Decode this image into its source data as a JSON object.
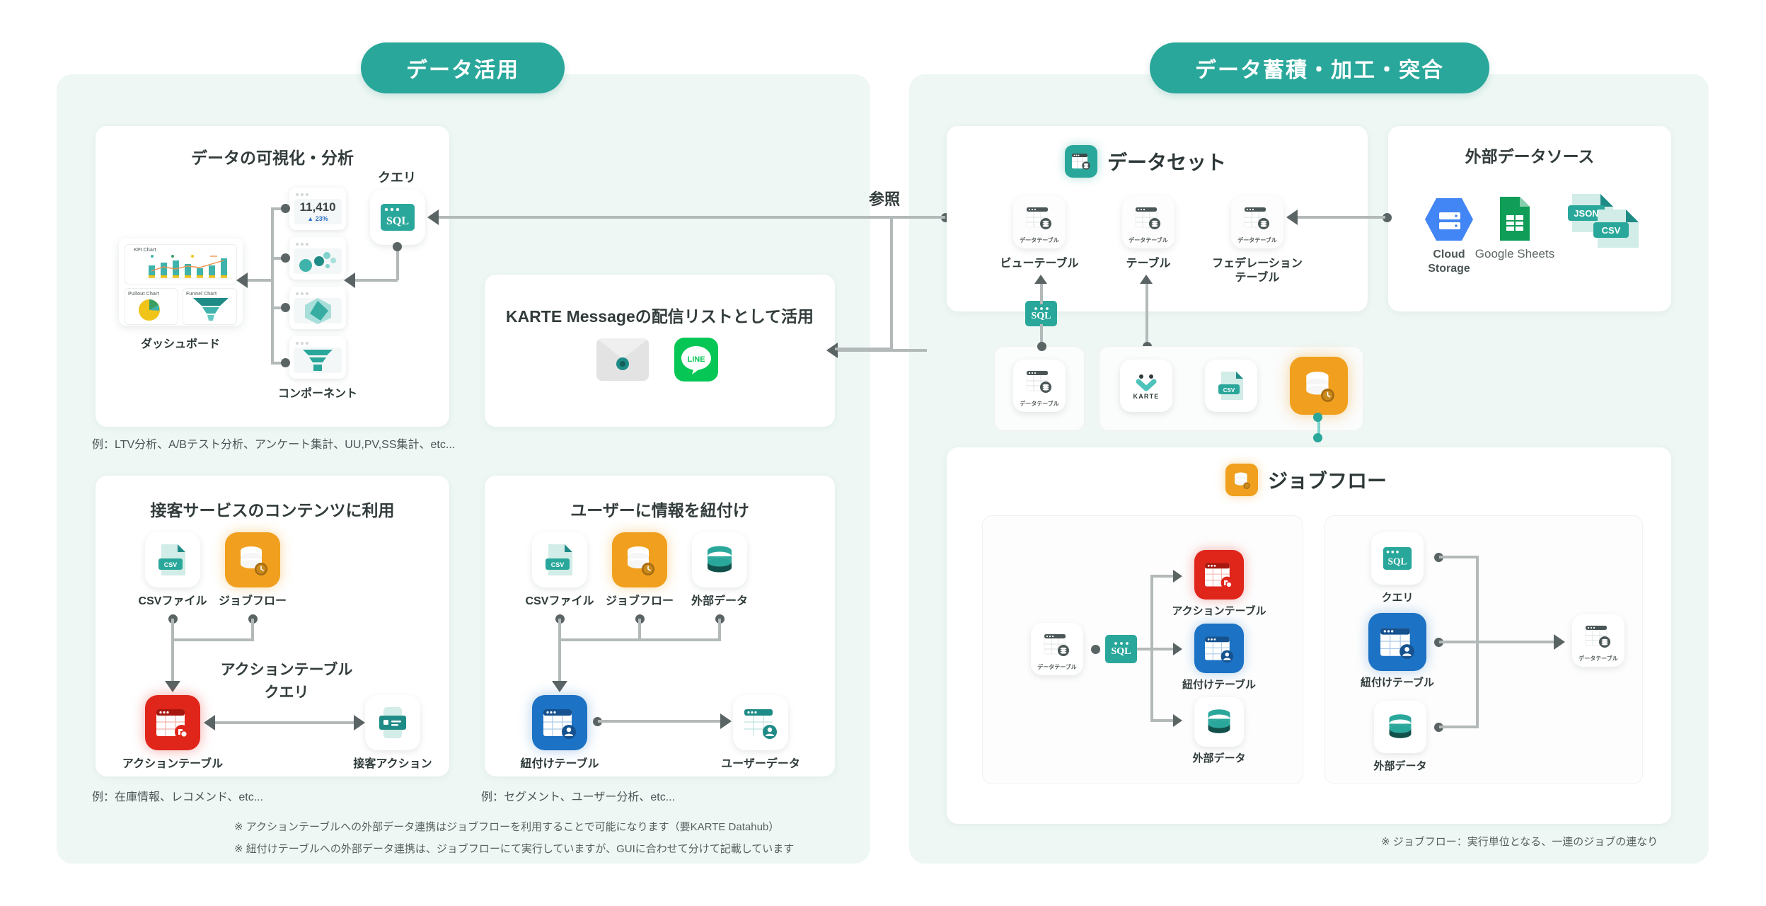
{
  "headers": {
    "left_pill": "データ活用",
    "right_pill": "データ蓄積・加工・突合"
  },
  "connector_labels": {
    "reference": "参照"
  },
  "left_panel": {
    "analysis_card": {
      "title": "データの可視化・分析",
      "dashboard_label": "ダッシュボード",
      "component_label": "コンポーネント",
      "query_label": "クエリ",
      "query_icon_text": "SQL",
      "kpi_value": "11,410",
      "kpi_delta": "▲ 23%",
      "dashboard_charts": [
        {
          "name": "KPI Chart"
        },
        {
          "name": "Pullout Chart"
        },
        {
          "name": "Funnel Chart"
        }
      ],
      "note": "例：LTV分析、A/Bテスト分析、アンケート集計、UU,PV,SS集計、etc..."
    },
    "message_card": {
      "title": "KARTE Messageの配信リストとして活用",
      "channels": [
        {
          "name": "mail-icon",
          "label": ""
        },
        {
          "name": "line-icon",
          "label": "LINE"
        }
      ]
    },
    "service_card": {
      "title": "接客サービスのコンテンツに利用",
      "sources": [
        {
          "label": "CSVファイル",
          "icon": "csv-file-icon",
          "badge": "CSV"
        },
        {
          "label": "ジョブフロー",
          "icon": "jobflow-icon"
        }
      ],
      "flow_label_line1": "アクションテーブル",
      "flow_label_line2": "クエリ",
      "action_table_label": "アクションテーブル",
      "action_label": "接客アクション",
      "note": "例：在庫情報、レコメンド、etc..."
    },
    "user_card": {
      "title": "ユーザーに情報を紐付け",
      "sources": [
        {
          "label": "CSVファイル",
          "icon": "csv-file-icon",
          "badge": "CSV"
        },
        {
          "label": "ジョブフロー",
          "icon": "jobflow-icon"
        },
        {
          "label": "外部データ",
          "icon": "database-icon"
        }
      ],
      "link_table_label": "紐付けテーブル",
      "user_data_label": "ユーザーデータ",
      "note": "例：セグメント、ユーザー分析、etc..."
    },
    "footnotes": [
      "※ アクションテーブルへの外部データ連携はジョブフローを利用することで可能になります（要KARTE Datahub）",
      "※ 紐付けテーブルへの外部データ連携は、ジョブフローにて実行していますが、GUIに合わせて分けて記載しています"
    ]
  },
  "right_panel": {
    "dataset_card": {
      "title": "データセット",
      "tables": [
        {
          "label": "ビューテーブル",
          "micro": "データテーブル"
        },
        {
          "label": "テーブル",
          "micro": "データテーブル"
        },
        {
          "label": "フェデレーションテーブル",
          "micro": "データテーブル"
        }
      ]
    },
    "external_card": {
      "title": "外部データソース",
      "sources": [
        {
          "label": "Cloud Storage",
          "icon": "cloud-storage-icon"
        },
        {
          "label": "Google Sheets",
          "icon": "google-sheets-icon"
        },
        {
          "label": "",
          "icon": "json-csv-files-icon",
          "badges": [
            "JSON",
            "CSV"
          ]
        }
      ]
    },
    "middle_row": {
      "sql_badge": "SQL",
      "data_table_micro": "データテーブル",
      "ingest_items": [
        {
          "label": "KARTE",
          "icon": "karte-icon"
        },
        {
          "label": "CSV",
          "icon": "csv-file-icon"
        },
        {
          "label": "",
          "icon": "jobflow-icon"
        }
      ]
    },
    "jobflow_card": {
      "title": "ジョブフロー",
      "flow_left": {
        "source": {
          "label": "",
          "micro": "データテーブル"
        },
        "sql_badge": "SQL",
        "targets": [
          {
            "label": "アクションテーブル",
            "icon": "action-table-icon"
          },
          {
            "label": "紐付けテーブル",
            "icon": "link-table-icon"
          },
          {
            "label": "外部データ",
            "icon": "database-icon"
          }
        ]
      },
      "flow_right": {
        "sources": [
          {
            "label": "クエリ",
            "icon": "sql-icon",
            "badge": "SQL"
          },
          {
            "label": "紐付けテーブル",
            "icon": "link-table-icon"
          },
          {
            "label": "外部データ",
            "icon": "database-icon"
          }
        ],
        "target": {
          "label": "",
          "micro": "データテーブル"
        }
      },
      "footnote": "※ ジョブフロー：実行単位となる、一連のジョブの連なり"
    }
  },
  "colors": {
    "teal": "#2aa79b",
    "panel_bg": "#eef7f4",
    "orange": "#f0a01e",
    "red": "#e0251b",
    "blue": "#1c72c4",
    "line": "#b3b9b9"
  }
}
